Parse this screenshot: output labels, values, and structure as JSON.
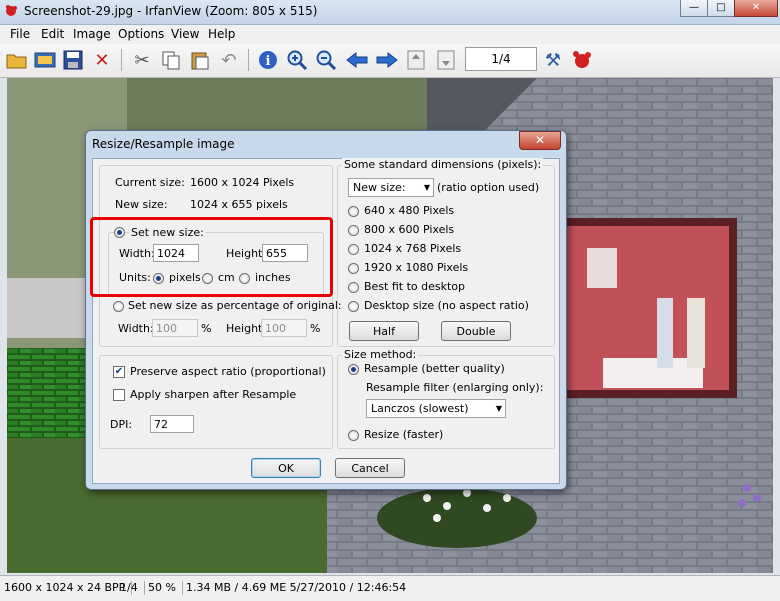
{
  "window": {
    "title": "Screenshot-29.jpg - IrfanView (Zoom: 805 x 515)",
    "min": "—",
    "max": "□",
    "close": "✕"
  },
  "menu": [
    "File",
    "Edit",
    "Image",
    "Options",
    "View",
    "Help"
  ],
  "toolbar": {
    "icons": [
      "open-folder-icon",
      "thumbnails-icon",
      "save-icon",
      "delete-icon",
      "cut-icon",
      "copy-icon",
      "paste-icon",
      "undo-icon",
      "info-icon",
      "zoom-in-icon",
      "zoom-out-icon",
      "previous-icon",
      "next-icon",
      "previous-file-icon",
      "next-file-icon",
      "properties-icon",
      "irfanview-logo-icon"
    ],
    "page_counter": "1/4"
  },
  "dialog": {
    "title": "Resize/Resample image",
    "close": "✕",
    "current_size_label": "Current size:",
    "current_size_value": "1600  x  1024  Pixels",
    "new_size_label": "New size:",
    "new_size_value": "1024  x  655  pixels",
    "set_new_size": "Set new size:",
    "width_label": "Width:",
    "width_value": "1024",
    "height_label": "Height:",
    "height_value": "655",
    "units_label": "Units:",
    "units": [
      "pixels",
      "cm",
      "inches"
    ],
    "set_percentage": "Set new size as percentage of original:",
    "pct_width_label": "Width:",
    "pct_width_value": "100",
    "pct_height_label": "Height:",
    "pct_height_value": "100",
    "pct_sign": "%",
    "preserve_aspect": "Preserve aspect ratio (proportional)",
    "apply_sharpen": "Apply sharpen after Resample",
    "dpi_label": "DPI:",
    "dpi_value": "72",
    "std_dims_title": "Some standard dimensions (pixels):",
    "new_size_select": "New size:",
    "ratio_note": "(ratio option used)",
    "std_options": [
      "640 x 480 Pixels",
      "800 x 600 Pixels",
      "1024 x 768 Pixels",
      "1920 x 1080 Pixels",
      "Best fit to desktop",
      "Desktop size (no aspect ratio)"
    ],
    "half": "Half",
    "double": "Double",
    "size_method_title": "Size method:",
    "resample": "Resample (better quality)",
    "resample_filter_label": "Resample filter (enlarging only):",
    "filter_value": "Lanczos (slowest)",
    "resize": "Resize (faster)",
    "ok": "OK",
    "cancel": "Cancel"
  },
  "status": {
    "dims": "1600 x 1024 x 24 BPP",
    "page": "1/4",
    "zoom": "50 %",
    "info": "1.34 MB / 4.69 ME 5/27/2010 / 12:46:54"
  },
  "colors": {
    "highlight": "#e60000",
    "title_bg": "#c3d4e7",
    "dialog_frame": "#c9d9ec"
  }
}
